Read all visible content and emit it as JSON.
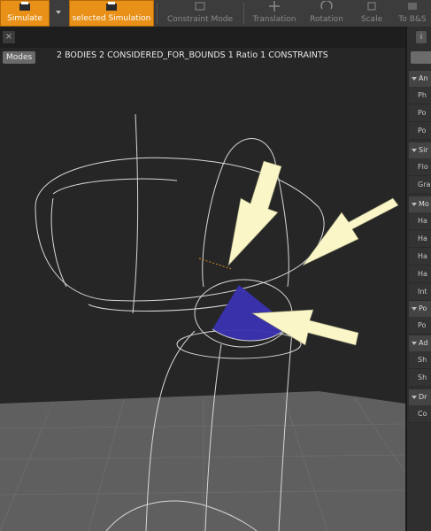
{
  "toolbar": {
    "simulate": "Simulate",
    "selected_simulation": "selected Simulation",
    "constraint_mode": "Constraint Mode",
    "translation": "Translation",
    "rotation": "Rotation",
    "scale": "Scale",
    "to_bs": "To B&S"
  },
  "viewport": {
    "modes": "Modes",
    "stats": "2 BODIES  2 CONSIDERED_FOR_BOUNDS  1 Ratio  1 CONSTRAINTS"
  },
  "panel": {
    "sections": [
      {
        "label": "An",
        "rows": [
          "Ph",
          "Po",
          "Po"
        ]
      },
      {
        "label": "Sir",
        "rows": [
          "Flo",
          "Gra"
        ]
      },
      {
        "label": "Mo",
        "rows": [
          "Ha",
          "Ha",
          "Ha",
          "Ha",
          "Int"
        ]
      },
      {
        "label": "Po",
        "rows": [
          "Po"
        ]
      },
      {
        "label": "Ad",
        "rows": [
          "Sh",
          "Sh"
        ]
      },
      {
        "label": "Dr",
        "rows": [
          "Co"
        ]
      }
    ]
  },
  "colors": {
    "accent_orange": "#e89018",
    "arrow_fill": "#fbf6c8",
    "wireframe": "#d8d8d8",
    "cone_blue": "#3a32b0"
  }
}
